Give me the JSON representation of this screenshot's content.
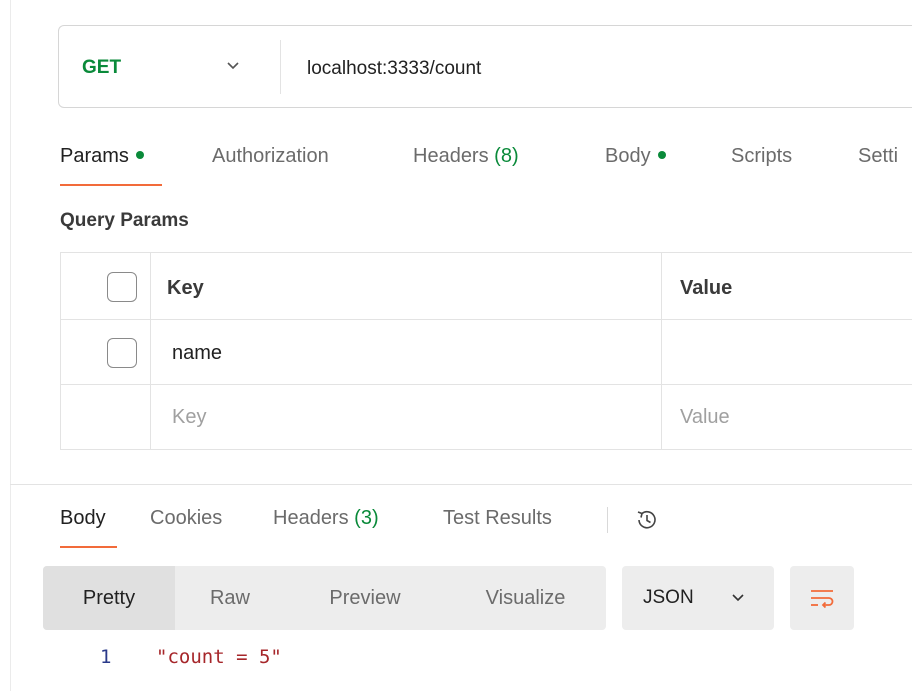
{
  "request": {
    "method": "GET",
    "url": "localhost:3333/count"
  },
  "request_tabs": {
    "params": "Params",
    "authorization": "Authorization",
    "headers": "Headers",
    "headers_count": "(8)",
    "body": "Body",
    "scripts": "Scripts",
    "settings": "Setti"
  },
  "query_params": {
    "title": "Query Params",
    "header_key": "Key",
    "header_value": "Value",
    "rows": [
      {
        "key": "name",
        "value": ""
      }
    ],
    "placeholder_key": "Key",
    "placeholder_value": "Value"
  },
  "response_tabs": {
    "body": "Body",
    "cookies": "Cookies",
    "headers": "Headers",
    "headers_count": "(3)",
    "test_results": "Test Results"
  },
  "format": {
    "pretty": "Pretty",
    "raw": "Raw",
    "preview": "Preview",
    "visualize": "Visualize",
    "selected_type": "JSON"
  },
  "response_body": {
    "lines": [
      {
        "number": "1",
        "text": "\"count = 5\""
      }
    ]
  },
  "icons": {
    "method_dropdown": "chevron-down-icon",
    "history": "history-icon",
    "wrap": "wrap-lines-icon"
  },
  "colors": {
    "accent": "#f26b3a",
    "method_green": "#0a8a3a",
    "string_red": "#a6262a"
  }
}
